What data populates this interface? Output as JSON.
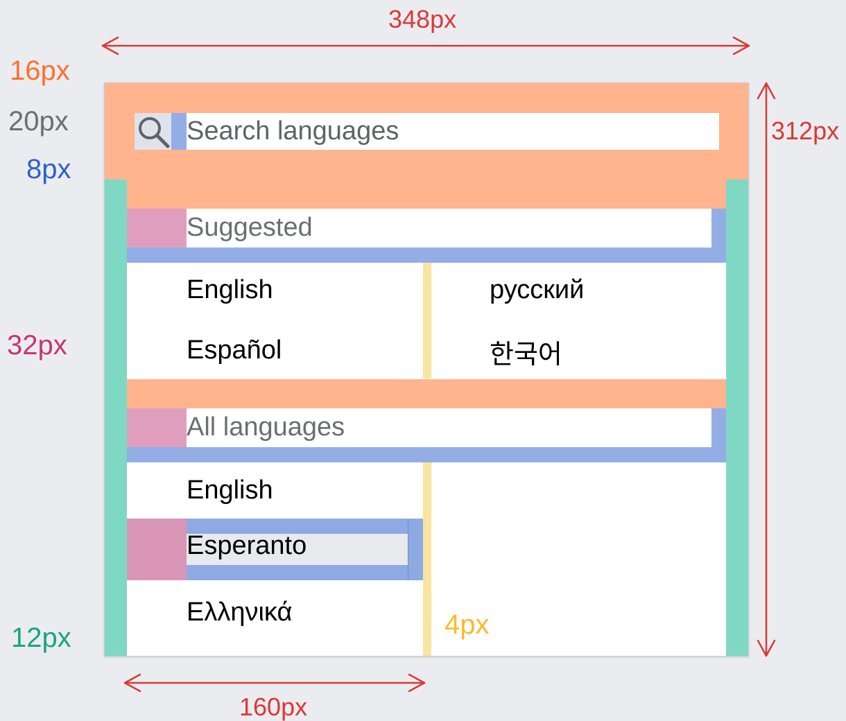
{
  "dimensions": {
    "width_label": "348px",
    "height_label": "312px",
    "column_label": "160px",
    "top_padding_label": "16px",
    "search_height_label": "20px",
    "search_gap_label": "8px",
    "item_indent_label": "32px",
    "side_padding_label": "12px",
    "column_gap_label": "4px"
  },
  "search": {
    "placeholder": "Search languages"
  },
  "sections": {
    "suggested": {
      "title": "Suggested",
      "column1": [
        "English",
        "Español"
      ],
      "column2": [
        "русский",
        "한국어"
      ]
    },
    "all": {
      "title": "All languages",
      "column1": [
        "English",
        "Esperanto",
        "Ελληνικά"
      ],
      "selected": "Esperanto"
    }
  },
  "colors": {
    "padding": "#ffb48e",
    "margin": "#7fd8c3",
    "spacing": "#93aee6",
    "indent": "#e09ebf",
    "gap": "#fbe4a0",
    "dimension": "#d83a36"
  }
}
